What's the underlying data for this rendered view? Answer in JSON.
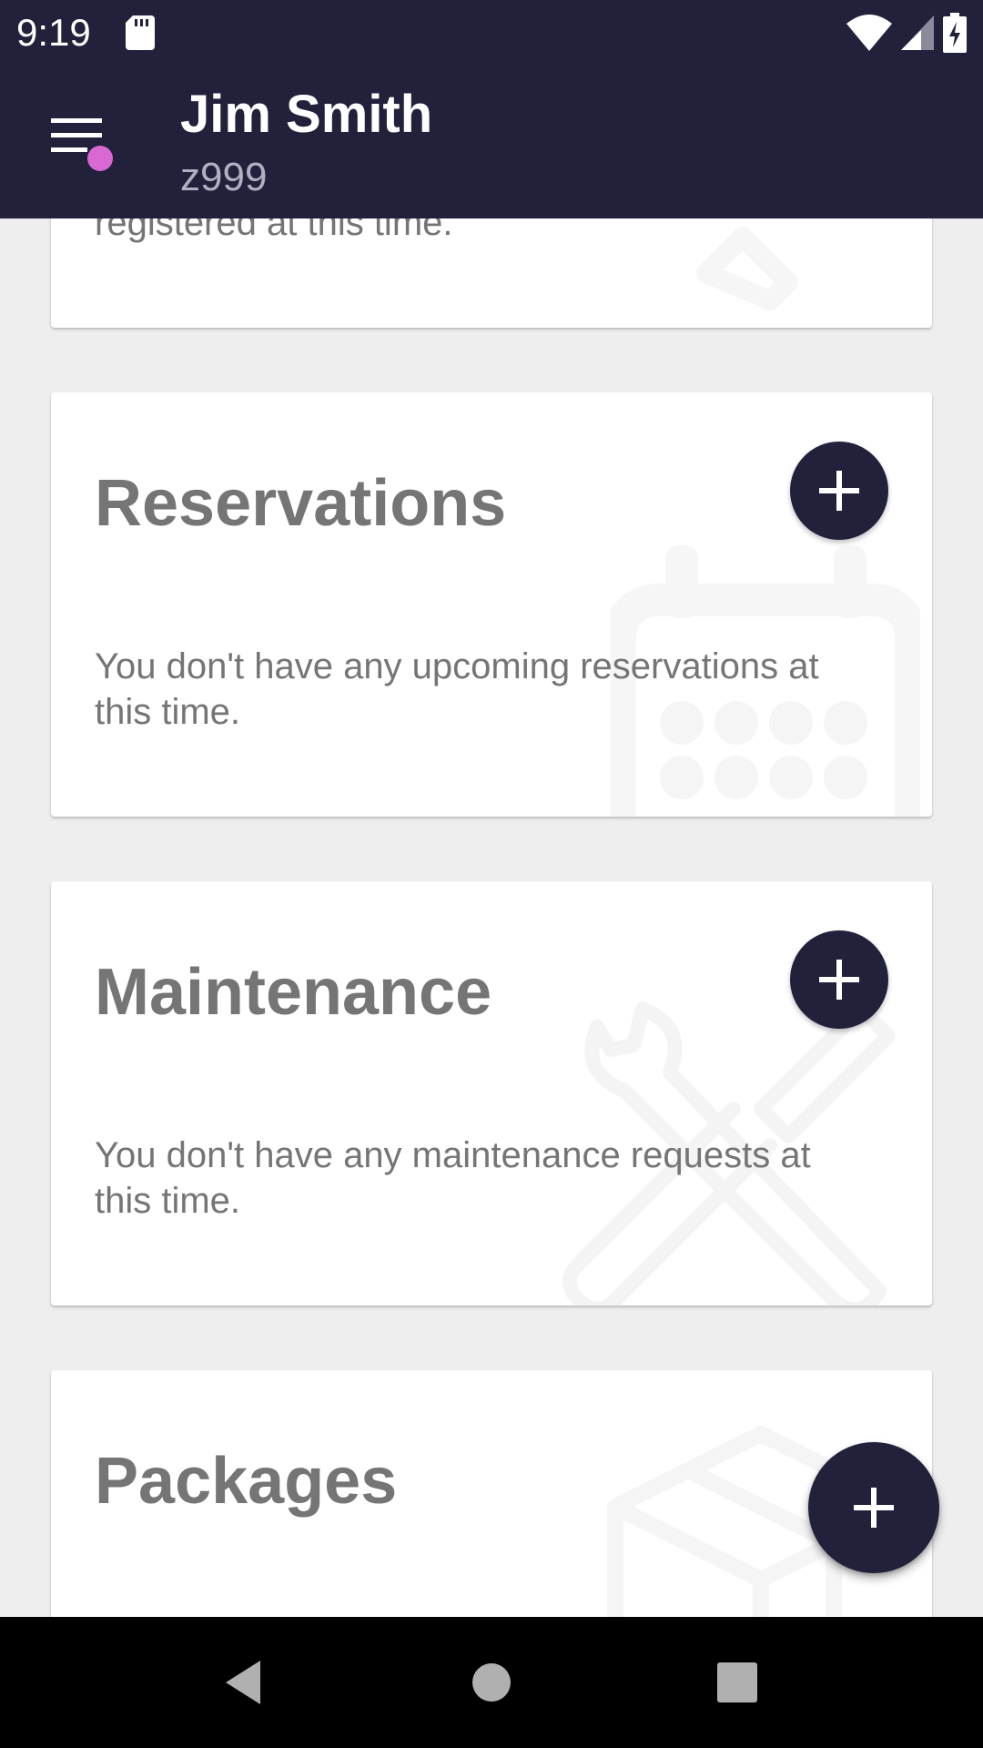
{
  "status_bar": {
    "time": "9:19",
    "icons": [
      "sd-card-icon",
      "wifi-icon",
      "signal-icon",
      "battery-charging-icon"
    ]
  },
  "app_bar": {
    "title": "Jim Smith",
    "subtitle": "z999",
    "menu_icon": "menu-icon",
    "notification_dot_color": "#d968d3"
  },
  "cards": {
    "top_partial": {
      "text": "registered at this time."
    },
    "reservations": {
      "title": "Reservations",
      "text": "You don't have any upcoming reservations at this time.",
      "bg_icon": "calendar-icon"
    },
    "maintenance": {
      "title": "Maintenance",
      "text": "You don't have any maintenance requests at this time.",
      "bg_icon": "tools-icon"
    },
    "packages": {
      "title": "Packages",
      "bg_icon": "package-icon"
    }
  },
  "fab": {
    "icon": "plus-icon"
  },
  "nav_bar": {
    "buttons": [
      "back-icon",
      "home-icon",
      "recents-icon"
    ]
  },
  "colors": {
    "primary": "#21213c",
    "background": "#eeeeee",
    "card": "#ffffff",
    "text_gray": "#757575"
  }
}
